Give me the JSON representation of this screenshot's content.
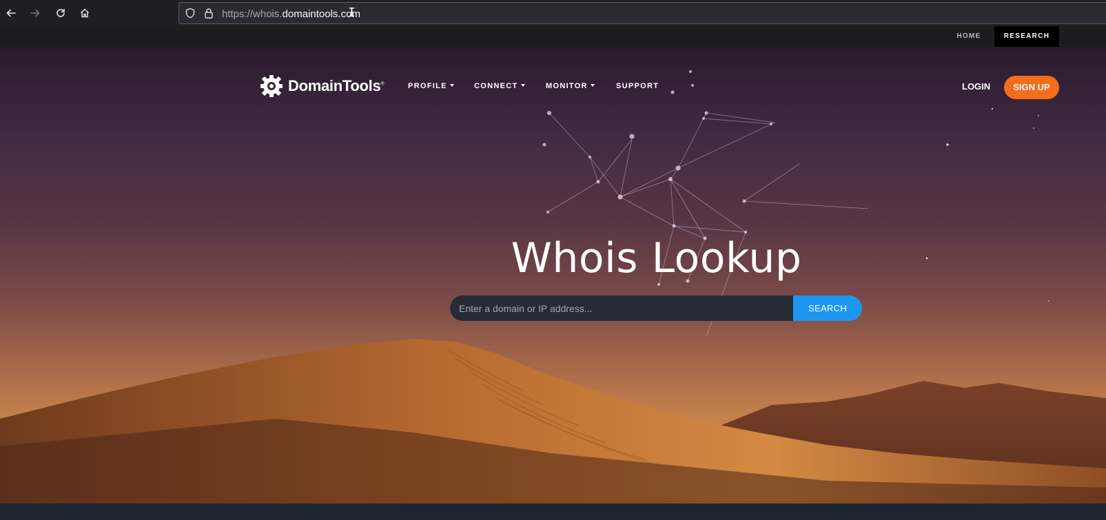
{
  "browser": {
    "url_prefix": "https://whois.",
    "url_host": "domaintools.",
    "url_suffix": "com",
    "icons": [
      "back-arrow-icon",
      "forward-arrow-icon",
      "reload-icon",
      "home-icon",
      "shield-icon",
      "lock-icon"
    ]
  },
  "top_strip": {
    "home": "HOME",
    "research": "RESEARCH"
  },
  "nav": {
    "logo_text": "DomainTools",
    "logo_mark": "®",
    "profile": "PROFILE",
    "connect": "CONNECT",
    "monitor": "MONITOR",
    "support": "SUPPORT",
    "login": "LOGIN",
    "signup": "SIGN UP"
  },
  "hero": {
    "title": "Whois Lookup",
    "search_placeholder": "Enter a domain or IP address...",
    "search_button": "SEARCH"
  },
  "colors": {
    "signup_accent": "#f36d1b",
    "search_button": "#1e96f0"
  }
}
